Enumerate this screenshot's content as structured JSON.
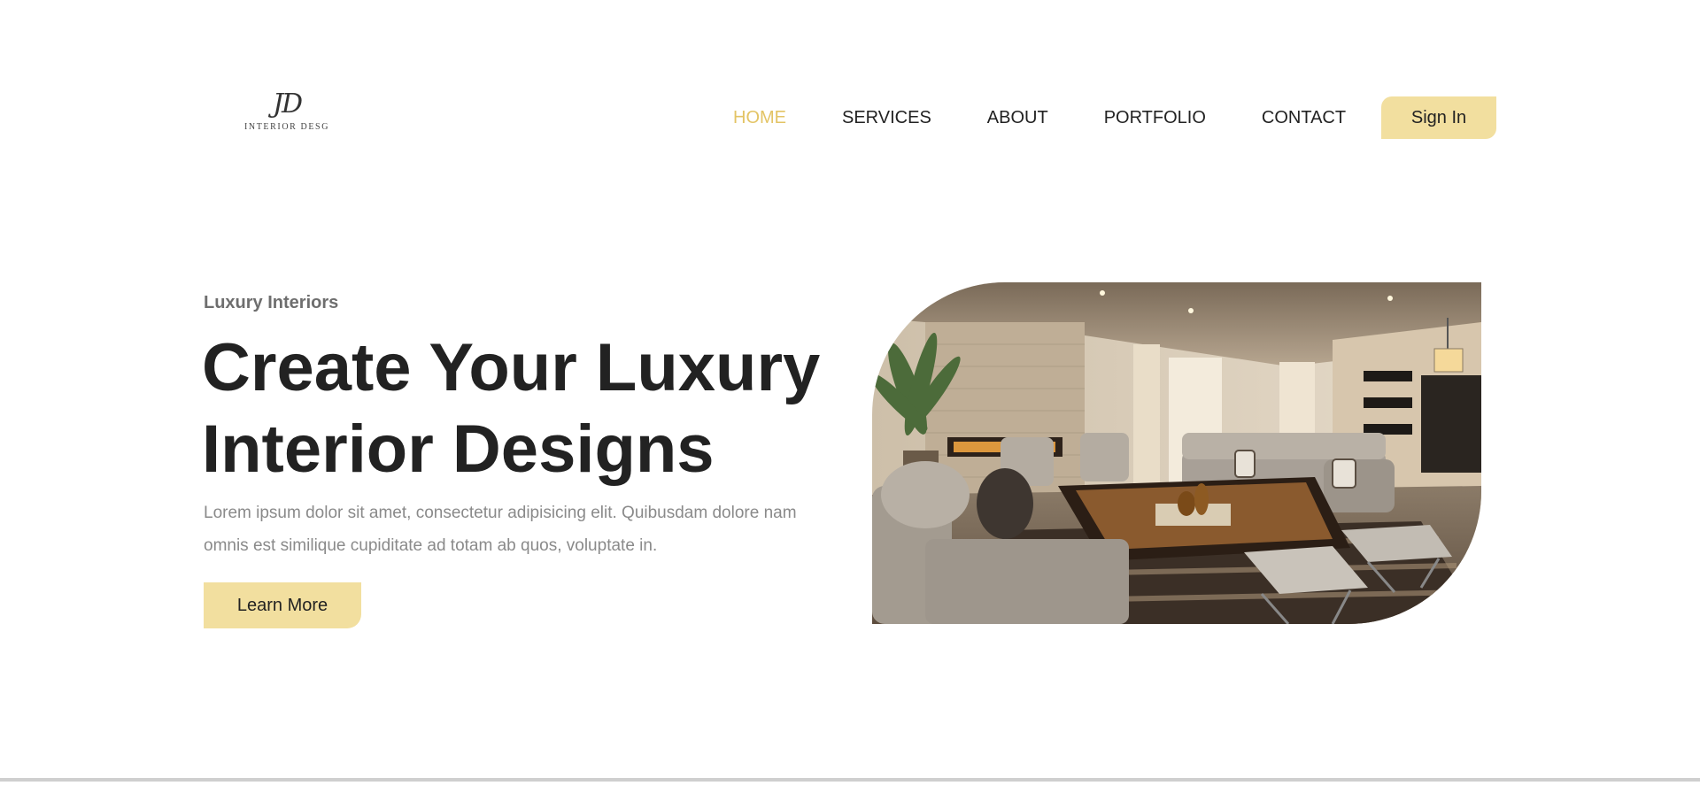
{
  "brand": {
    "monogram": "JD",
    "wordmark": "INTERIOR DESG"
  },
  "nav": {
    "items": [
      {
        "label": "HOME",
        "active": true
      },
      {
        "label": "SERVICES",
        "active": false
      },
      {
        "label": "ABOUT",
        "active": false
      },
      {
        "label": "PORTFOLIO",
        "active": false
      },
      {
        "label": "CONTACT",
        "active": false
      }
    ],
    "signin_label": "Sign In"
  },
  "hero": {
    "eyebrow": "Luxury Interiors",
    "title_line1": "Create Your Luxury",
    "title_line2": "Interior Designs",
    "description": "Lorem ipsum dolor sit amet, consectetur adipisicing elit. Quibusdam dolore nam omnis est similique cupiditate ad totam ab quos, voluptate in.",
    "cta_label": "Learn More"
  },
  "colors": {
    "accent": "#f2df9f",
    "active_nav": "#e3c465",
    "heading": "#222222",
    "body_text": "#8a8a8a"
  }
}
